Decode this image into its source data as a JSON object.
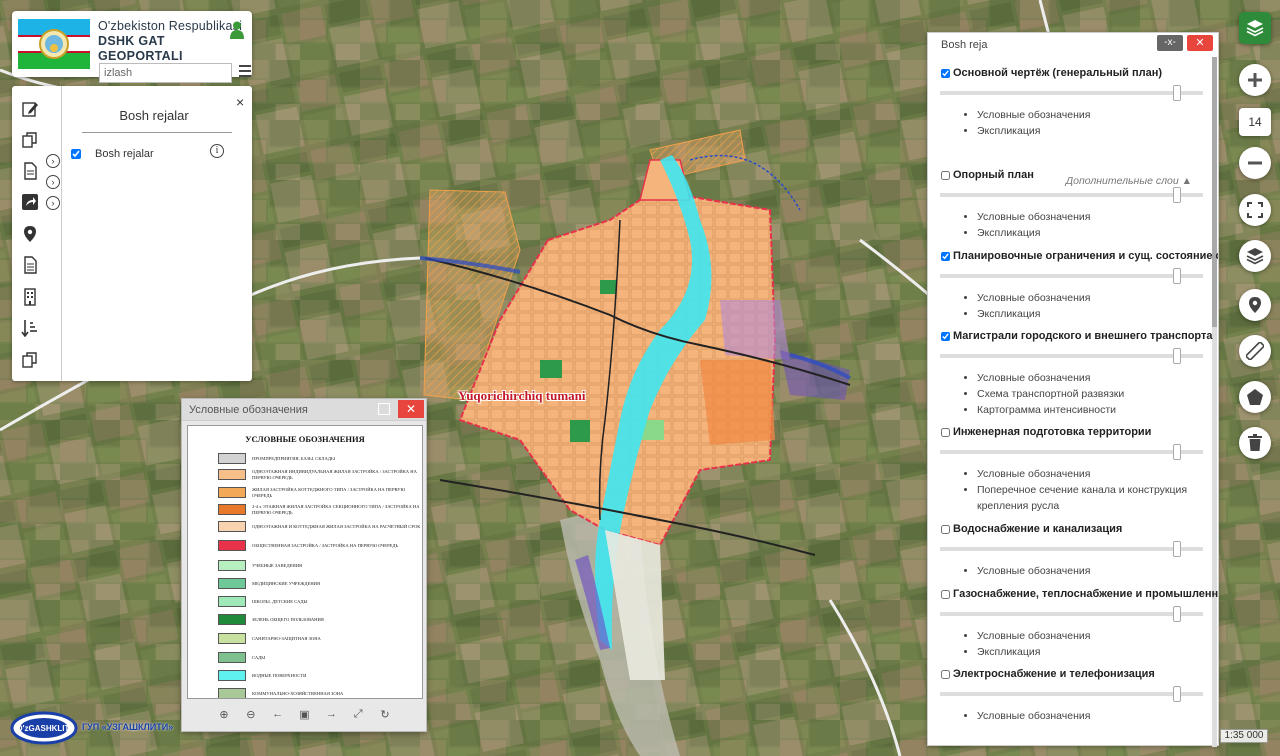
{
  "header": {
    "title_line1": "O'zbekiston Respublikasi",
    "title_line2": "DSHK GAT GEOPORTALI",
    "search_placeholder": "izlash"
  },
  "left_panel": {
    "title": "Bosh rejalar",
    "close": "×",
    "layers": [
      {
        "label": "Bosh rejalar",
        "checked": true
      }
    ],
    "tools": [
      "edit-icon",
      "copy-icon",
      "document-icon",
      "share-icon",
      "location-pin-icon",
      "file-icon",
      "building-icon",
      "sort-icon",
      "duplicate-icon"
    ]
  },
  "map": {
    "district_label": "Yuqorichirchiq tumani",
    "scale": "1:35 000",
    "zoom_level": "14",
    "logo_text": "O'zGASHKLITI",
    "logo_caption": "ГУП «УЗГАШКЛИТИ»"
  },
  "legend_window": {
    "title": "Условные обозначения",
    "close": "✕",
    "sheet_title": "УСЛОВНЫЕ ОБОЗНАЧЕНИЯ",
    "entries": [
      {
        "color": "#d3d3d3",
        "label": "ПРОМПРЕДПРИЯТИЯ, БАЗЫ, СКЛАДЫ"
      },
      {
        "color": "#f7c08a",
        "label": "ОДНОЭТАЖНАЯ ИНДИВИДУАЛЬНАЯ ЖИЛАЯ ЗАСТРОЙКА / ЗАСТРОЙКА НА ПЕРВУЮ ОЧЕРЕДЬ"
      },
      {
        "color": "#f3a858",
        "label": "ЖИЛАЯ ЗАСТРОЙКА КОТТЕДЖНОГО ТИПА / ЗАСТРОЙКА НА ПЕРВУЮ ОЧЕРЕДЬ"
      },
      {
        "color": "#e8792b",
        "label": "2-4 х ЭТАЖНАЯ ЖИЛАЯ ЗАСТРОЙКА СЕКЦИОННОГО ТИПА / ЗАСТРОЙКА НА ПЕРВУЮ ОЧЕРЕДЬ"
      },
      {
        "color": "#f9d2b0",
        "label": "ОДНОЭТАЖНАЯ И КОТТЕДЖНАЯ ЖИЛАЯ ЗАСТРОЙКА НА РАСЧЕТНЫЙ СРОК"
      },
      {
        "color": "#e8324a",
        "label": "ОБЩЕСТВЕННАЯ ЗАСТРОЙКА / ЗАСТРОЙКА НА ПЕРВУЮ ОЧЕРЕДЬ"
      },
      {
        "color": "#b7f0c0",
        "label": "УЧЕБНЫЕ ЗАВЕДЕНИЯ"
      },
      {
        "color": "#6fc898",
        "label": "МЕДИЦИНСКИЕ УЧРЕЖДЕНИЯ"
      },
      {
        "color": "#9fe8b8",
        "label": "ШКОЛЫ, ДЕТСКИЕ САДЫ"
      },
      {
        "color": "#1f8a3a",
        "label": "ЗЕЛЕНЬ ОБЩЕГО ПОЛЬЗОВАНИЯ"
      },
      {
        "color": "#c8e0a0",
        "label": "САНИТАРНО-ЗАЩИТНАЯ ЗОНА"
      },
      {
        "color": "#7fc08f",
        "label": "САДЫ"
      },
      {
        "color": "#5ff0f0",
        "label": "ВОДНЫЕ ПОВЕРХНОСТИ"
      },
      {
        "color": "#a8c898",
        "label": "КОММУНАЛЬНО-ХОЗЯЙСТВЕННАЯ ЗОНА"
      }
    ],
    "tools": [
      "⊕",
      "⊖",
      "←",
      "▣",
      "→",
      "⤢",
      "↻"
    ]
  },
  "right_panel": {
    "title": "Bosh reja",
    "minimize": "-x-",
    "close": "✕",
    "extra_layers_label": "Дополнительные слои",
    "sections": [
      {
        "title": "Основной чертёж (генеральный план)",
        "checked": true,
        "opacity": 0.9,
        "items": [
          "Условные обозначения",
          "Экспликация"
        ]
      },
      {
        "title": "Опорный план",
        "checked": false,
        "opacity": 0.9,
        "items": [
          "Условные обозначения",
          "Экспликация"
        ]
      },
      {
        "title": "Планировочные ограничения и сущ. состояние среды",
        "checked": true,
        "opacity": 0.9,
        "items": [
          "Условные обозначения",
          "Экспликация"
        ]
      },
      {
        "title": "Магистрали городского и внешнего транспорта",
        "checked": true,
        "opacity": 0.9,
        "items": [
          "Условные обозначения",
          "Схема транспортной развязки",
          "Картограмма интенсивности"
        ]
      },
      {
        "title": "Инженерная подготовка территории",
        "checked": false,
        "opacity": 0.9,
        "items": [
          "Условные обозначения",
          "Поперечное сечение канала и конструкция крепления русла"
        ]
      },
      {
        "title": "Водоснабжение и канализация",
        "checked": false,
        "opacity": 0.9,
        "items": [
          "Условные обозначения"
        ]
      },
      {
        "title": "Газоснабжение, теплоснабжение и промышленность",
        "checked": false,
        "opacity": 0.9,
        "items": [
          "Условные обозначения",
          "Экспликация"
        ]
      },
      {
        "title": "Электроснабжение и телефонизация",
        "checked": false,
        "opacity": 0.9,
        "items": [
          "Условные обозначения"
        ]
      }
    ]
  },
  "right_toolbar": [
    "layers-icon",
    "zoom-in-icon",
    "zoom-out-icon",
    "fullscreen-icon",
    "basemap-layers-icon",
    "location-icon",
    "ruler-icon",
    "polygon-icon",
    "trash-icon"
  ]
}
